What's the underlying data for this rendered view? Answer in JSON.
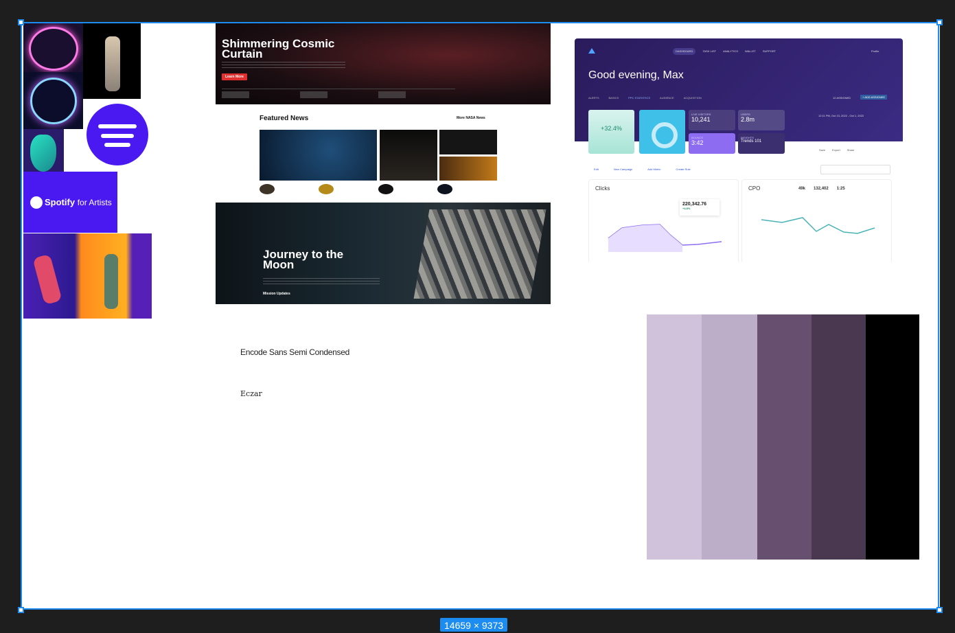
{
  "canvas": {
    "dimensions_label": "14659 × 9373"
  },
  "moodboard": {
    "spotify_logo_text": "Spotify for Artists",
    "spotify_logo_word": "Spotify",
    "spotify_logo_suffix": "for Artists"
  },
  "nasa": {
    "hero_title_line1": "Shimmering Cosmic",
    "hero_title_line2": "Curtain",
    "hero_button": "Learn More",
    "featured_heading": "Featured News",
    "more_news_link": "More NASA News",
    "journey_title_line1": "Journey to the",
    "journey_title_line2": "Moon",
    "journey_link": "Mission Updates"
  },
  "dashboard": {
    "greeting": "Good evening, Max",
    "nav": [
      "DASHBOARD",
      "TASK LIST",
      "ANALYTICS",
      "WALLET",
      "SUPPORT"
    ],
    "profile": "Profile",
    "tabs": [
      "ALERTS",
      "BASICS",
      "PPC STATISTICS",
      "AUDIENCE",
      "ACQUISITION"
    ],
    "assigned": "12 ASSIGNED",
    "add_assignee": "+ ADD ASSIGNEE",
    "timeframe": "12:11 PM, Oct 13, 2022 - Oct 1, 2022",
    "kpi_impressions_value": "+32.4%",
    "kpi_live_visitors_label": "LIVE VISITORS",
    "kpi_live_visitors_value": "10,241",
    "kpi_users_label": "USERS",
    "kpi_users_value": "2.8m",
    "kpi_bounce_label": "BOUNCE",
    "kpi_bounce_value": "3:42",
    "kpi_insights_label": "INSIGHTS",
    "kpi_insights_value": "Trends 101",
    "toolbar": [
      "Edit",
      "New Campaign",
      "Add Metric",
      "Create Rule"
    ],
    "clicks_title": "Clicks",
    "clicks_value": "220,342.76",
    "clicks_change": "+4.8%",
    "cpo_title": "CPO",
    "cpo_stats": [
      "49k",
      "132,402",
      "1:25"
    ],
    "actions": [
      "Save",
      "Export",
      "Share"
    ]
  },
  "fonts": {
    "primary": "Encode Sans Semi Condensed",
    "secondary": "Eczar"
  },
  "palette": {
    "colors": [
      "#d0c2db",
      "#bcadc9",
      "#67506f",
      "#4a3750",
      "#000000"
    ]
  },
  "colors": {
    "selection": "#1d8cf0",
    "spotify_purple": "#4a19f2",
    "nasa_red": "#e03030"
  }
}
